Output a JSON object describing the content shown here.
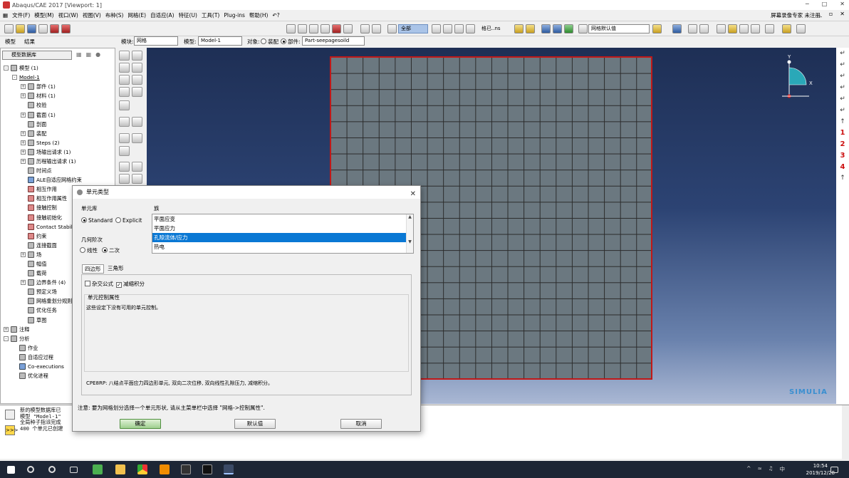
{
  "window": {
    "title": "Abaqus/CAE 2017 [Viewport: 1]",
    "min": "─",
    "max": "□",
    "close": "✕"
  },
  "menu": {
    "items": [
      "文件(F)",
      "模型(M)",
      "视口(W)",
      "视图(V)",
      "布种(S)",
      "网格(E)",
      "自适应(A)",
      "特征(U)",
      "工具(T)",
      "Plug-ins",
      "帮助(H)",
      "↶?"
    ],
    "right_text": "屏幕录像专家 未注册",
    "rbtns": [
      "_",
      "▫",
      "✕"
    ]
  },
  "toolbar": {
    "all_label": "全部",
    "mesh_default": "网格默认值",
    "grid_label": "格已..ns"
  },
  "modelrow": {
    "tab_model": "模型",
    "tab_results": "结果",
    "module_label": "模块:",
    "module_value": "网格",
    "model_label": "模型:",
    "model_value": "Model-1",
    "object_label": "对象:",
    "assembly_label": "装配",
    "part_label": "部件:",
    "part_value": "Part-seepagesoild"
  },
  "tree": {
    "header": "模型数据库",
    "nodes": [
      {
        "indent": 0,
        "pm": "-",
        "icon": "k",
        "label": "模型 (1)"
      },
      {
        "indent": 1,
        "pm": "-",
        "icon": "",
        "label": "Model-1"
      },
      {
        "indent": 2,
        "pm": "+",
        "icon": "k",
        "label": "部件 (1)"
      },
      {
        "indent": 2,
        "pm": "+",
        "icon": "k",
        "label": "材料 (1)"
      },
      {
        "indent": 2,
        "pm": "",
        "icon": "k",
        "label": "校验"
      },
      {
        "indent": 2,
        "pm": "+",
        "icon": "k",
        "label": "截面 (1)"
      },
      {
        "indent": 2,
        "pm": "",
        "icon": "k",
        "label": "剖面"
      },
      {
        "indent": 2,
        "pm": "+",
        "icon": "k",
        "label": "装配"
      },
      {
        "indent": 2,
        "pm": "+",
        "icon": "k",
        "label": "Steps (2)"
      },
      {
        "indent": 2,
        "pm": "+",
        "icon": "k",
        "label": "场输出请求 (1)"
      },
      {
        "indent": 2,
        "pm": "+",
        "icon": "k",
        "label": "历程输出请求 (1)"
      },
      {
        "indent": 2,
        "pm": "",
        "icon": "k",
        "label": "时间点"
      },
      {
        "indent": 2,
        "pm": "",
        "icon": "b",
        "label": "ALE自适应网格约束"
      },
      {
        "indent": 2,
        "pm": "",
        "icon": "r",
        "label": "相互作用"
      },
      {
        "indent": 2,
        "pm": "",
        "icon": "r",
        "label": "相互作用属性"
      },
      {
        "indent": 2,
        "pm": "",
        "icon": "r",
        "label": "接触控制"
      },
      {
        "indent": 2,
        "pm": "",
        "icon": "r",
        "label": "接触初始化"
      },
      {
        "indent": 2,
        "pm": "",
        "icon": "r",
        "label": "Contact Stabiliz..."
      },
      {
        "indent": 2,
        "pm": "",
        "icon": "r",
        "label": "约束"
      },
      {
        "indent": 2,
        "pm": "",
        "icon": "k",
        "label": "连接截面"
      },
      {
        "indent": 2,
        "pm": "+",
        "icon": "k",
        "label": "场"
      },
      {
        "indent": 2,
        "pm": "",
        "icon": "k",
        "label": "幅值"
      },
      {
        "indent": 2,
        "pm": "",
        "icon": "k",
        "label": "载荷"
      },
      {
        "indent": 2,
        "pm": "+",
        "icon": "k",
        "label": "边界条件 (4)"
      },
      {
        "indent": 2,
        "pm": "",
        "icon": "k",
        "label": "预定义场"
      },
      {
        "indent": 2,
        "pm": "",
        "icon": "k",
        "label": "网格重划分规则"
      },
      {
        "indent": 2,
        "pm": "",
        "icon": "k",
        "label": "优化任务"
      },
      {
        "indent": 2,
        "pm": "",
        "icon": "k",
        "label": "草图"
      },
      {
        "indent": 0,
        "pm": "+",
        "icon": "k",
        "label": "注释"
      },
      {
        "indent": 0,
        "pm": "-",
        "icon": "k",
        "label": "分析"
      },
      {
        "indent": 1,
        "pm": "",
        "icon": "k",
        "label": "作业"
      },
      {
        "indent": 1,
        "pm": "",
        "icon": "k",
        "label": "自适应过程"
      },
      {
        "indent": 1,
        "pm": "",
        "icon": "b",
        "label": "Co-executions"
      },
      {
        "indent": 1,
        "pm": "",
        "icon": "k",
        "label": "优化进程"
      }
    ]
  },
  "viewport": {
    "triad_y": "Y",
    "triad_x": "X",
    "brand": "SIMULIA"
  },
  "rightstrip": [
    "↵",
    "↵",
    "↵",
    "↵",
    "↵",
    "↵",
    "↑",
    "1",
    "2",
    "3",
    "4",
    "↑"
  ],
  "messages": [
    "新的模型数据库已",
    "模型 \"Model-1\"",
    "全局种子指派完成",
    "400 个单元已创建"
  ],
  "dialog": {
    "title": "单元类型",
    "close": "✕",
    "lib_label": "单元库",
    "lib_standard": "Standard",
    "lib_explicit": "Explicit",
    "family_label": "族",
    "families": [
      "平面应变",
      "平面应力",
      "孔隙流体/应力",
      "热电"
    ],
    "selected_family": 2,
    "order_label": "几何阶次",
    "order_linear": "线性",
    "order_quadratic": "二次",
    "tab_quad": "四边形",
    "tab_tri": "三角形",
    "hybrid": "杂交公式",
    "reduced": "减缩积分",
    "ctrl_label": "单元控制属性",
    "ctrl_text": "这些设定下没有可用的单元控制。",
    "desc": "CPE8RP: 八结点平面应力四边形单元, 双向二次位移, 双向线性孔隙压力, 减缩积分。",
    "note": "注意: 要为网格划分选择一个单元形状, 请从主菜单栏中选择 \"网格->控制属性\".",
    "ok": "确定",
    "defaults": "默认值",
    "cancel": "取消"
  },
  "taskbar": {
    "time": "10:54",
    "date": "2019/12/28",
    "ime": "中"
  }
}
